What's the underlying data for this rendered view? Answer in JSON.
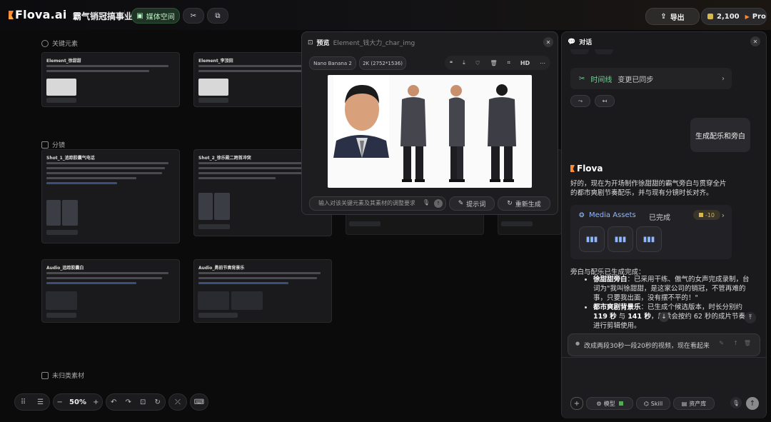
{
  "header": {
    "logo": "Flova.ai",
    "project_title": "霸气销冠搞事业",
    "media_space_label": "媒体空间",
    "export_label": "导出",
    "credits": "2,100",
    "plan_badge": "Pro"
  },
  "canvas": {
    "section_elements": "关键元素",
    "section_storyboard": "分镜",
    "section_uncategorized": "未归类素材",
    "cards": [
      {
        "title": "Element_徐甜甜"
      },
      {
        "title": "Element_李顶田"
      },
      {
        "title": "Shot_1_追踪胶囊气电话"
      },
      {
        "title": "Shot_2_徐乐殿二跨首冲突"
      },
      {
        "title": "Audio_追踪胶囊白"
      },
      {
        "title": "Audio_勇前节奏背景乐"
      }
    ]
  },
  "bottom_toolbar": {
    "zoom": "50%"
  },
  "preview": {
    "title_label": "预览",
    "file_name": "Element_钱大力_char_img",
    "model": "Nano Banana 2",
    "resolution": "2K (2752*1536)",
    "hd_label": "HD",
    "input_placeholder": "输入对该关键元素及其素材的调整要求",
    "prompt_button": "提示词",
    "regenerate_button": "重新生成"
  },
  "chat": {
    "title": "对话",
    "timeline_label": "时间线",
    "timeline_status": "变更已同步",
    "user_message": "生成配乐和旁白",
    "bot_name": "Flova",
    "bot_intro": "好的，现在为开场制作徐甜甜的霸气旁白与贯穿全片的都市爽剧节奏配乐，并与现有分镜时长对齐。",
    "assets_title": "Media Assets",
    "assets_status": "已完成",
    "assets_cost": "-10",
    "done_text": "旁白与配乐已生成完成：",
    "bullet1_title": "徐甜甜旁白",
    "bullet1_text": "：已采用干练、傲气的女声完成录制，台词为\"我叫徐甜甜，是这家公司的销冠，不管再难的事，只要我出面，没有摆不平的！\"",
    "bullet2_title": "都市爽剧背景乐",
    "bullet2_pre": "：已生成",
    "bullet2_mid": "个候选版本，时长分别约 ",
    "bullet2_a": "119 秒",
    "bullet2_and": " 与 ",
    "bullet2_b": "141 秒",
    "bullet2_post": "，后续会按约 62 秒的成片节奏进行剪辑使用。",
    "queued_message": "改成两段30秒一段20秒的视频，现在看起来",
    "model_label": "模型",
    "skill_label": "Skill",
    "assets_label": "资产库"
  },
  "colors": {
    "accent_green": "#b9f2c6",
    "brand_orange": "#ff8a30",
    "timeline_green": "#74d39a",
    "assets_blue": "#8fb8ff"
  }
}
